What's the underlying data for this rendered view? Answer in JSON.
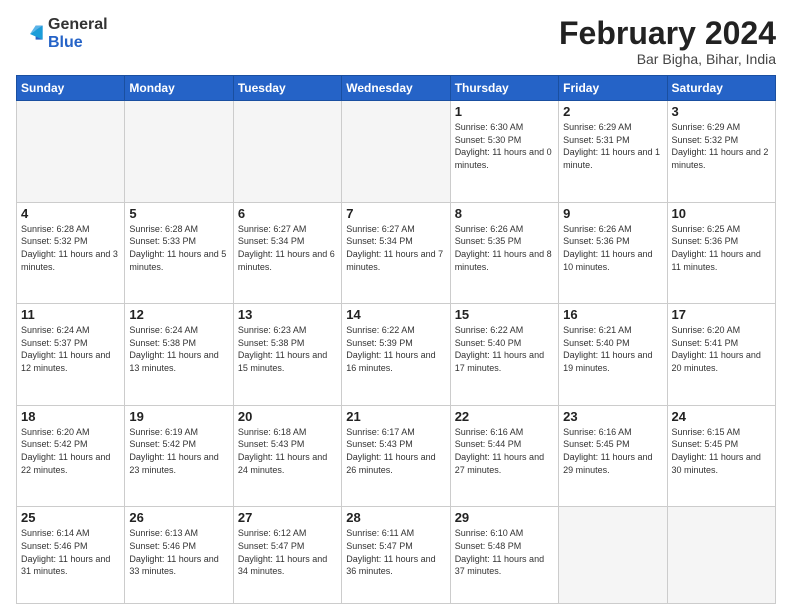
{
  "header": {
    "logo": {
      "general": "General",
      "blue": "Blue"
    },
    "title": "February 2024",
    "subtitle": "Bar Bigha, Bihar, India"
  },
  "weekdays": [
    "Sunday",
    "Monday",
    "Tuesday",
    "Wednesday",
    "Thursday",
    "Friday",
    "Saturday"
  ],
  "weeks": [
    [
      {
        "day": "",
        "info": ""
      },
      {
        "day": "",
        "info": ""
      },
      {
        "day": "",
        "info": ""
      },
      {
        "day": "",
        "info": ""
      },
      {
        "day": "1",
        "info": "Sunrise: 6:30 AM\nSunset: 5:30 PM\nDaylight: 11 hours and 0 minutes."
      },
      {
        "day": "2",
        "info": "Sunrise: 6:29 AM\nSunset: 5:31 PM\nDaylight: 11 hours and 1 minute."
      },
      {
        "day": "3",
        "info": "Sunrise: 6:29 AM\nSunset: 5:32 PM\nDaylight: 11 hours and 2 minutes."
      }
    ],
    [
      {
        "day": "4",
        "info": "Sunrise: 6:28 AM\nSunset: 5:32 PM\nDaylight: 11 hours and 3 minutes."
      },
      {
        "day": "5",
        "info": "Sunrise: 6:28 AM\nSunset: 5:33 PM\nDaylight: 11 hours and 5 minutes."
      },
      {
        "day": "6",
        "info": "Sunrise: 6:27 AM\nSunset: 5:34 PM\nDaylight: 11 hours and 6 minutes."
      },
      {
        "day": "7",
        "info": "Sunrise: 6:27 AM\nSunset: 5:34 PM\nDaylight: 11 hours and 7 minutes."
      },
      {
        "day": "8",
        "info": "Sunrise: 6:26 AM\nSunset: 5:35 PM\nDaylight: 11 hours and 8 minutes."
      },
      {
        "day": "9",
        "info": "Sunrise: 6:26 AM\nSunset: 5:36 PM\nDaylight: 11 hours and 10 minutes."
      },
      {
        "day": "10",
        "info": "Sunrise: 6:25 AM\nSunset: 5:36 PM\nDaylight: 11 hours and 11 minutes."
      }
    ],
    [
      {
        "day": "11",
        "info": "Sunrise: 6:24 AM\nSunset: 5:37 PM\nDaylight: 11 hours and 12 minutes."
      },
      {
        "day": "12",
        "info": "Sunrise: 6:24 AM\nSunset: 5:38 PM\nDaylight: 11 hours and 13 minutes."
      },
      {
        "day": "13",
        "info": "Sunrise: 6:23 AM\nSunset: 5:38 PM\nDaylight: 11 hours and 15 minutes."
      },
      {
        "day": "14",
        "info": "Sunrise: 6:22 AM\nSunset: 5:39 PM\nDaylight: 11 hours and 16 minutes."
      },
      {
        "day": "15",
        "info": "Sunrise: 6:22 AM\nSunset: 5:40 PM\nDaylight: 11 hours and 17 minutes."
      },
      {
        "day": "16",
        "info": "Sunrise: 6:21 AM\nSunset: 5:40 PM\nDaylight: 11 hours and 19 minutes."
      },
      {
        "day": "17",
        "info": "Sunrise: 6:20 AM\nSunset: 5:41 PM\nDaylight: 11 hours and 20 minutes."
      }
    ],
    [
      {
        "day": "18",
        "info": "Sunrise: 6:20 AM\nSunset: 5:42 PM\nDaylight: 11 hours and 22 minutes."
      },
      {
        "day": "19",
        "info": "Sunrise: 6:19 AM\nSunset: 5:42 PM\nDaylight: 11 hours and 23 minutes."
      },
      {
        "day": "20",
        "info": "Sunrise: 6:18 AM\nSunset: 5:43 PM\nDaylight: 11 hours and 24 minutes."
      },
      {
        "day": "21",
        "info": "Sunrise: 6:17 AM\nSunset: 5:43 PM\nDaylight: 11 hours and 26 minutes."
      },
      {
        "day": "22",
        "info": "Sunrise: 6:16 AM\nSunset: 5:44 PM\nDaylight: 11 hours and 27 minutes."
      },
      {
        "day": "23",
        "info": "Sunrise: 6:16 AM\nSunset: 5:45 PM\nDaylight: 11 hours and 29 minutes."
      },
      {
        "day": "24",
        "info": "Sunrise: 6:15 AM\nSunset: 5:45 PM\nDaylight: 11 hours and 30 minutes."
      }
    ],
    [
      {
        "day": "25",
        "info": "Sunrise: 6:14 AM\nSunset: 5:46 PM\nDaylight: 11 hours and 31 minutes."
      },
      {
        "day": "26",
        "info": "Sunrise: 6:13 AM\nSunset: 5:46 PM\nDaylight: 11 hours and 33 minutes."
      },
      {
        "day": "27",
        "info": "Sunrise: 6:12 AM\nSunset: 5:47 PM\nDaylight: 11 hours and 34 minutes."
      },
      {
        "day": "28",
        "info": "Sunrise: 6:11 AM\nSunset: 5:47 PM\nDaylight: 11 hours and 36 minutes."
      },
      {
        "day": "29",
        "info": "Sunrise: 6:10 AM\nSunset: 5:48 PM\nDaylight: 11 hours and 37 minutes."
      },
      {
        "day": "",
        "info": ""
      },
      {
        "day": "",
        "info": ""
      }
    ]
  ]
}
